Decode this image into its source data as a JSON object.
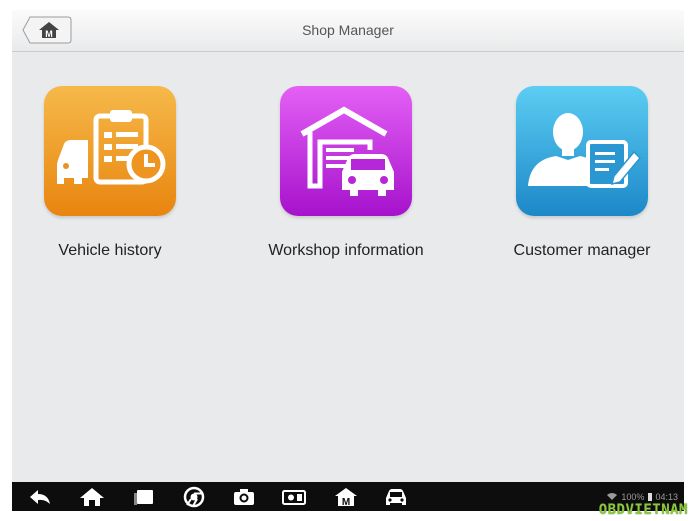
{
  "header": {
    "title": "Shop Manager",
    "home_icon": "home-m-icon"
  },
  "tiles": [
    {
      "label": "Vehicle history",
      "icon": "vehicle-history-icon",
      "color": "#ef9a1c"
    },
    {
      "label": "Workshop information",
      "icon": "workshop-garage-icon",
      "color": "#b21fd9"
    },
    {
      "label": "Customer manager",
      "icon": "customer-manager-icon",
      "color": "#1f8fcf"
    }
  ],
  "navbar": {
    "icons": [
      "back-icon",
      "home-icon",
      "recent-apps-icon",
      "chrome-icon",
      "camera-icon",
      "display-settings-icon",
      "m-logo-icon",
      "vehicle-icon"
    ]
  },
  "status": {
    "battery": "100%",
    "time": "04:13"
  },
  "watermark": "OBDVIETNAM"
}
